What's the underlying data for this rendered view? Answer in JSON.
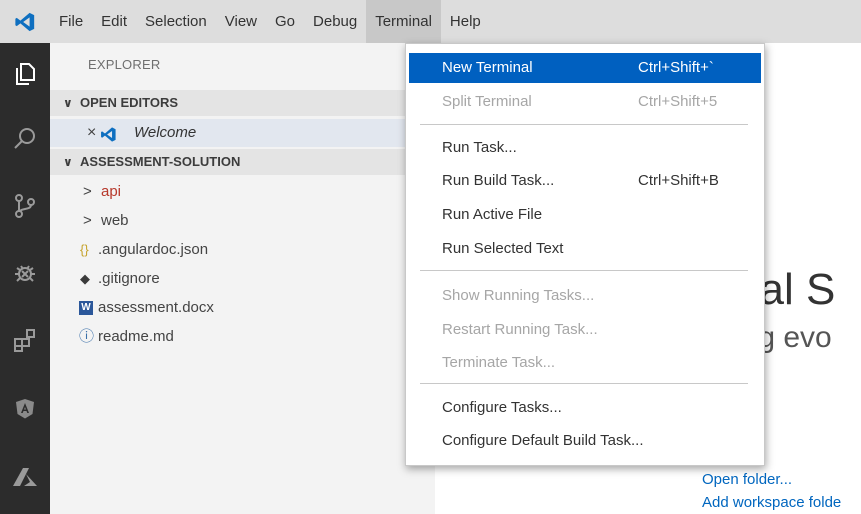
{
  "menubar": {
    "items": [
      "File",
      "Edit",
      "Selection",
      "View",
      "Go",
      "Debug",
      "Terminal",
      "Help"
    ],
    "active": "Terminal"
  },
  "activitybar": {
    "icons": [
      "explorer-icon",
      "search-icon",
      "source-control-icon",
      "debug-icon",
      "extensions-icon",
      "angular-icon",
      "azure-icon"
    ]
  },
  "sidebar": {
    "title": "EXPLORER",
    "open_editors": {
      "label": "OPEN EDITORS",
      "items": [
        {
          "close": "×",
          "name": "Welcome"
        }
      ]
    },
    "project": {
      "label": "ASSESSMENT-SOLUTION",
      "items": [
        {
          "chevron": ">",
          "name": "api",
          "color": "#b7392c"
        },
        {
          "chevron": ">",
          "name": "web",
          "color": "#444444"
        },
        {
          "icon": "{}",
          "name": ".angulardoc.json"
        },
        {
          "icon": "◆",
          "name": ".gitignore"
        },
        {
          "icon": "W",
          "name": "assessment.docx"
        },
        {
          "icon": "ⓘ",
          "name": "readme.md"
        }
      ]
    }
  },
  "editor": {
    "heading_fragment": "ual S",
    "sub_fragment": "ing evo",
    "links": [
      "Open folder...",
      "Add workspace folde"
    ]
  },
  "terminal_menu": {
    "items": [
      {
        "label": "New Terminal",
        "shortcut": "Ctrl+Shift+`",
        "state": "highlight"
      },
      {
        "label": "Split Terminal",
        "shortcut": "Ctrl+Shift+5",
        "state": "disabled"
      },
      {
        "label": "Run Task...",
        "shortcut": "",
        "state": "normal"
      },
      {
        "label": "Run Build Task...",
        "shortcut": "Ctrl+Shift+B",
        "state": "normal"
      },
      {
        "label": "Run Active File",
        "shortcut": "",
        "state": "normal"
      },
      {
        "label": "Run Selected Text",
        "shortcut": "",
        "state": "normal"
      },
      {
        "label": "Show Running Tasks...",
        "shortcut": "",
        "state": "disabled"
      },
      {
        "label": "Restart Running Task...",
        "shortcut": "",
        "state": "disabled"
      },
      {
        "label": "Terminate Task...",
        "shortcut": "",
        "state": "disabled"
      },
      {
        "label": "Configure Tasks...",
        "shortcut": "",
        "state": "normal"
      },
      {
        "label": "Configure Default Build Task...",
        "shortcut": "",
        "state": "normal"
      }
    ]
  },
  "colors": {
    "accent": "#0060c0",
    "vscode_blue": "#0e6fc0",
    "activitybar": "#2c2c2c",
    "link": "#0066bf"
  }
}
